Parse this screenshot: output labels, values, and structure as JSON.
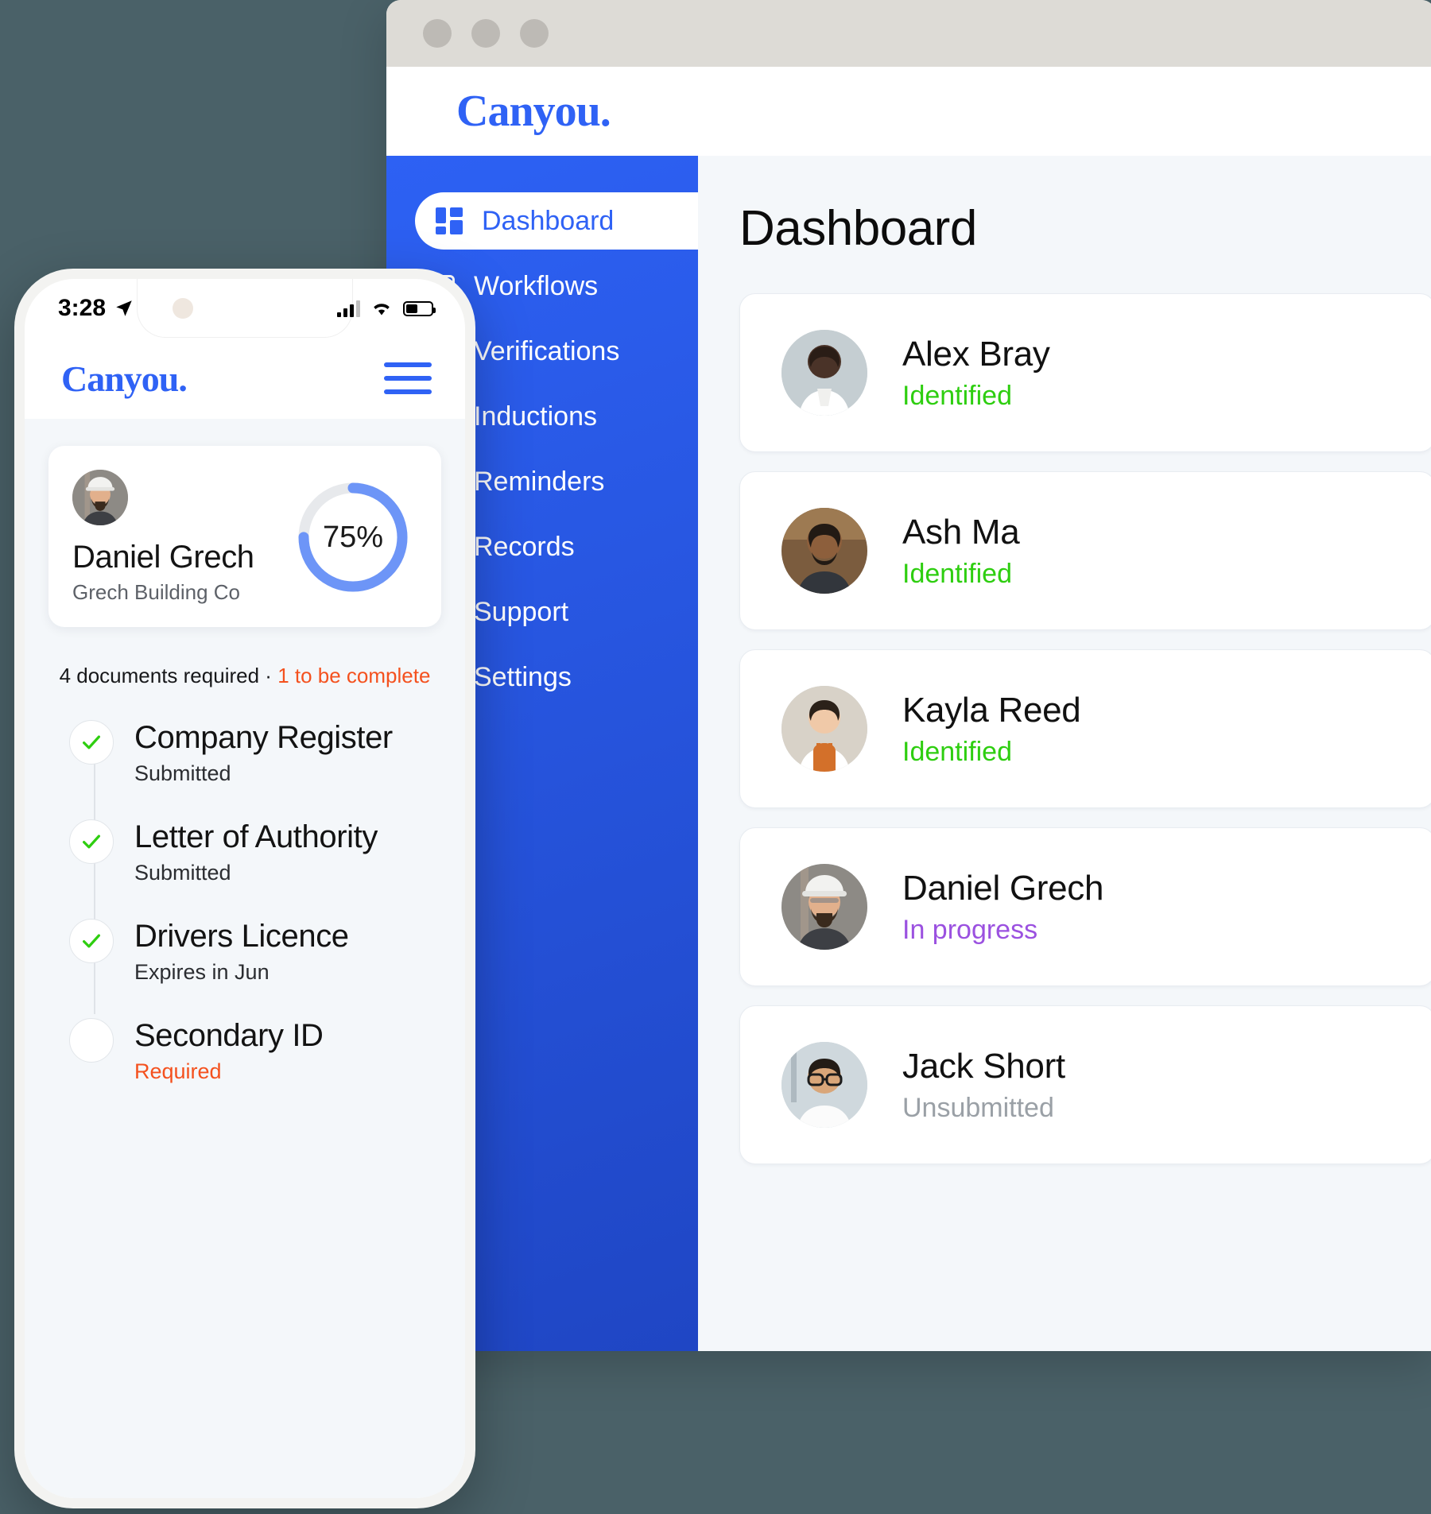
{
  "theme": {
    "page_background": "#4a6168",
    "brand_blue": "#2f62f5",
    "sidebar_blue": "#2d61f4",
    "status_green": "#2ece10",
    "status_purple": "#9b51e0",
    "status_grey": "#9aa0a6",
    "warn_orange": "#f4511e",
    "content_background": "#f4f7fa"
  },
  "desktop": {
    "window_controls": [
      "close-dot",
      "minimize-dot",
      "maximize-dot"
    ],
    "brand": "Canyou.",
    "sidebar": {
      "items": [
        {
          "label": "Dashboard",
          "icon": "dashboard-icon",
          "active": true
        },
        {
          "label": "Workflows",
          "icon": "workflows-icon",
          "active": false
        },
        {
          "label": "Verifications",
          "icon": "verifications-icon",
          "active": false
        },
        {
          "label": "Inductions",
          "icon": "inductions-icon",
          "active": false
        },
        {
          "label": "Reminders",
          "icon": "reminders-icon",
          "active": false
        },
        {
          "label": "Records",
          "icon": "records-icon",
          "active": false
        },
        {
          "label": "Support",
          "icon": "support-icon",
          "active": false
        },
        {
          "label": "Settings",
          "icon": "settings-icon",
          "active": false
        }
      ]
    },
    "main": {
      "title": "Dashboard",
      "people": [
        {
          "name": "Alex Bray",
          "status": "Identified",
          "status_color": "#2ece10",
          "avatar": "avatar-alex-bray"
        },
        {
          "name": "Ash Ma",
          "status": "Identified",
          "status_color": "#2ece10",
          "avatar": "avatar-ash-ma"
        },
        {
          "name": "Kayla Reed",
          "status": "Identified",
          "status_color": "#2ece10",
          "avatar": "avatar-kayla-reed"
        },
        {
          "name": "Daniel Grech",
          "status": "In progress",
          "status_color": "#9b51e0",
          "avatar": "avatar-daniel-grech"
        },
        {
          "name": "Jack Short",
          "status": "Unsubmitted",
          "status_color": "#9aa0a6",
          "avatar": "avatar-jack-short"
        }
      ]
    }
  },
  "phone": {
    "status_bar": {
      "time": "3:28",
      "location_icon": "location-arrow-icon",
      "signal_icon": "cellular-bars-icon",
      "wifi_icon": "wifi-icon",
      "battery_icon": "battery-icon"
    },
    "header": {
      "brand": "Canyou.",
      "menu_icon": "hamburger-menu-icon"
    },
    "profile_card": {
      "avatar": "avatar-daniel-grech",
      "name": "Daniel Grech",
      "company": "Grech Building Co",
      "progress_label": "75%",
      "progress_value": 75
    },
    "documents_summary": {
      "required_text": "4 documents required",
      "separator": "·",
      "pending_text": "1 to be complete"
    },
    "checklist": [
      {
        "title": "Company Register",
        "status": "Submitted",
        "complete": true,
        "required": false
      },
      {
        "title": "Letter of Authority",
        "status": "Submitted",
        "complete": true,
        "required": false
      },
      {
        "title": "Drivers Licence",
        "status": "Expires in Jun",
        "complete": true,
        "required": false
      },
      {
        "title": "Secondary ID",
        "status": "Required",
        "complete": false,
        "required": true
      }
    ]
  }
}
